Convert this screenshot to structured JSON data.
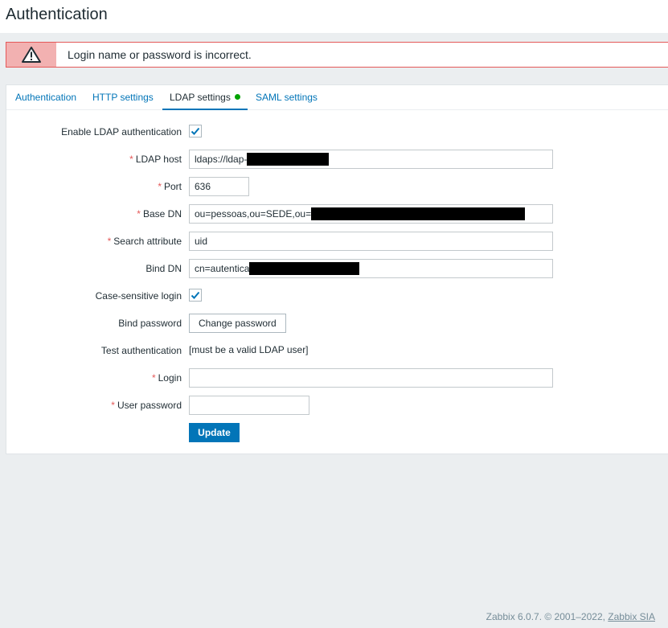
{
  "page": {
    "title": "Authentication"
  },
  "message": {
    "text": "Login name or password is incorrect.",
    "icon": "warning-icon"
  },
  "tabs": [
    {
      "label": "Authentication"
    },
    {
      "label": "HTTP settings"
    },
    {
      "label": "LDAP settings"
    },
    {
      "label": "SAML settings"
    }
  ],
  "form": {
    "enable_ldap": {
      "label": "Enable LDAP authentication",
      "checked": true
    },
    "ldap_host": {
      "label": "LDAP host",
      "value": "ldaps://ldap-"
    },
    "port": {
      "label": "Port",
      "value": "636"
    },
    "base_dn": {
      "label": "Base DN",
      "value": "ou=pessoas,ou=SEDE,ou="
    },
    "search_attribute": {
      "label": "Search attribute",
      "value": "uid"
    },
    "bind_dn": {
      "label": "Bind DN",
      "value": "cn=autentica"
    },
    "case_sensitive": {
      "label": "Case-sensitive login",
      "checked": true
    },
    "bind_password": {
      "label": "Bind password",
      "button": "Change password"
    },
    "test_auth": {
      "label": "Test authentication",
      "text": "[must be a valid LDAP user]"
    },
    "login": {
      "label": "Login",
      "value": ""
    },
    "user_password": {
      "label": "User password",
      "value": ""
    },
    "update_button": "Update",
    "required_marker": "*"
  },
  "footer": {
    "text": "Zabbix 6.0.7. © 2001–2022, ",
    "link": "Zabbix SIA"
  },
  "colors": {
    "accent": "#0275b8",
    "error": "#e45959",
    "error_bg": "#f2b1b1",
    "status_green": "#00a302",
    "background": "#ebeef0"
  }
}
